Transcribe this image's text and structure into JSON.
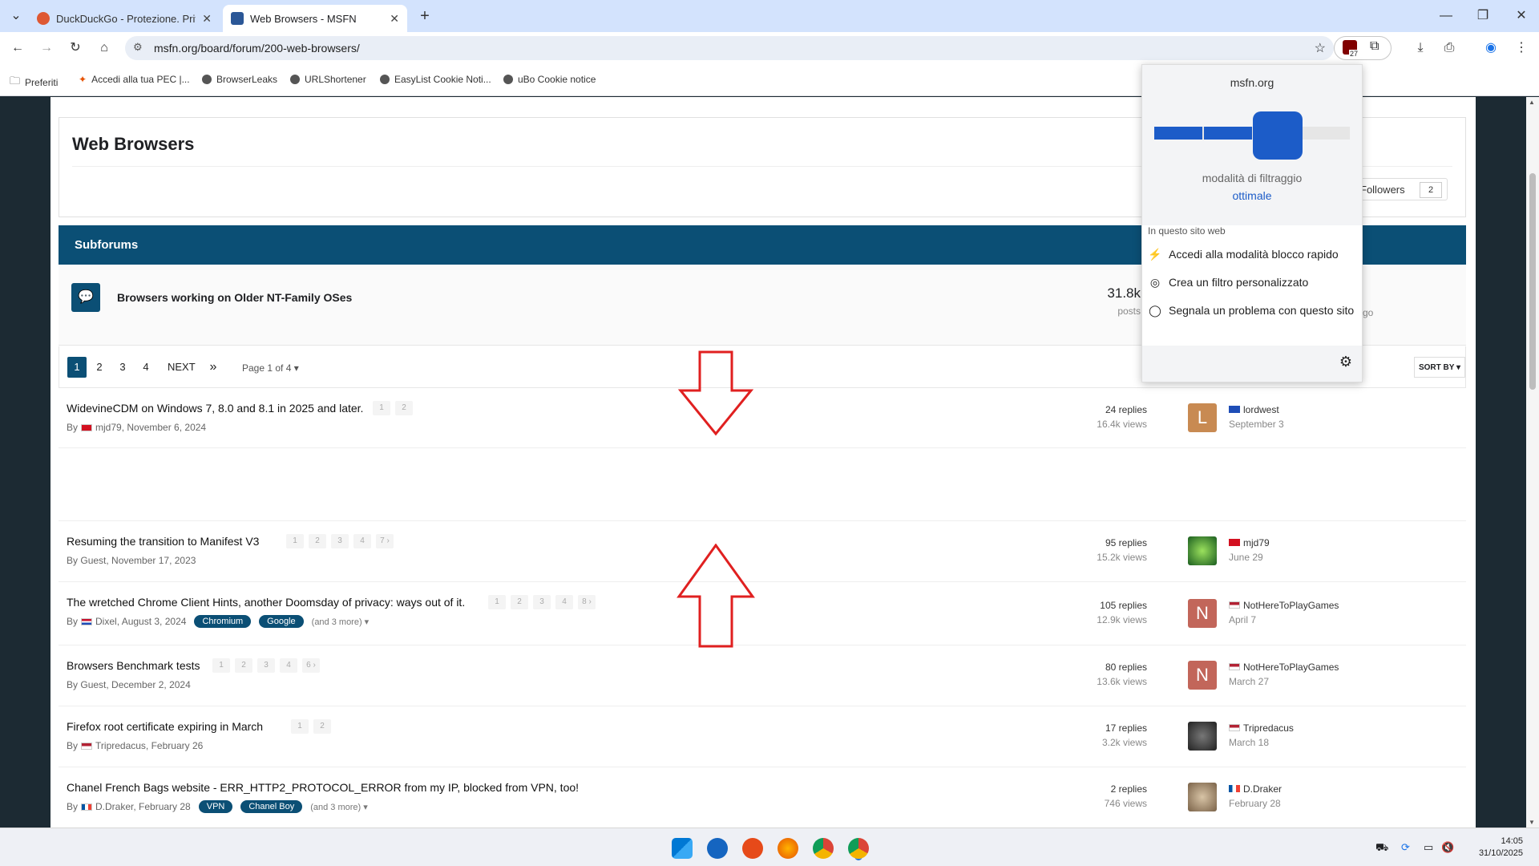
{
  "browser": {
    "tabs": [
      {
        "label": "DuckDuckGo - Protezione. Priva",
        "color": "#de5833"
      },
      {
        "label": "Web Browsers - MSFN",
        "color": "#2b5797"
      }
    ],
    "url": "msfn.org/board/forum/200-web-browsers/",
    "ext_badge": "27",
    "bookmarks": [
      {
        "label": "Preferiti"
      },
      {
        "label": "Accedi alla tua PEC |..."
      },
      {
        "label": "BrowserLeaks"
      },
      {
        "label": "URLShortener"
      },
      {
        "label": "EasyList Cookie Noti..."
      },
      {
        "label": "uBo Cookie notice"
      }
    ]
  },
  "page": {
    "title": "Web Browsers",
    "followers_label": "Followers",
    "followers_count": "2",
    "subforums_label": "Subforums",
    "subforum": {
      "title": "Browsers working on Older NT-Family OSes",
      "count": "31.8k",
      "posts_label": "posts",
      "ago": "go"
    },
    "pager": {
      "pages": [
        "1",
        "2",
        "3",
        "4"
      ],
      "next": "NEXT",
      "last": "»",
      "info": "Page 1 of 4 ▾",
      "sort": "SORT BY ▾"
    },
    "topics": [
      {
        "title": "WidevineCDM on Windows 7, 8.0 and 8.1 in 2025 and later.",
        "pages": [
          "1",
          "2"
        ],
        "by": "By",
        "author": "mjd79, November 6, 2024",
        "flag": "#d31020",
        "replies": "24 replies",
        "views": "16.4k views",
        "avatar_letter": "L",
        "avatar_color": "#c88a52",
        "last_user": "lordwest",
        "last_flag": "#1e4db7",
        "last_date": "September 3",
        "tags": [],
        "more": ""
      },
      {
        "title": "Resuming the transition to Manifest V3",
        "pages": [
          "1",
          "2",
          "3",
          "4",
          "7 ›"
        ],
        "by": "By",
        "author": "Guest, November 17, 2023",
        "flag": "",
        "replies": "95 replies",
        "views": "15.2k views",
        "avatar_letter": "",
        "avatar_color": "#2e7d32",
        "last_user": "mjd79",
        "last_flag": "#d31020",
        "last_date": "June 29",
        "tags": [],
        "more": ""
      },
      {
        "title": "The wretched Chrome Client Hints, another Doomsday of privacy: ways out of it.",
        "pages": [
          "1",
          "2",
          "3",
          "4",
          "8 ›"
        ],
        "by": "By",
        "author": "Dixel, August 3, 2024",
        "flag": "#1e4db7",
        "replies": "105 replies",
        "views": "12.9k views",
        "avatar_letter": "N",
        "avatar_color": "#c2665a",
        "last_user": "NotHereToPlayGames",
        "last_flag": "#b22234",
        "last_date": "April 7",
        "tags": [
          "Chromium",
          "Google"
        ],
        "more": "(and 3 more) ▾"
      },
      {
        "title": "Browsers Benchmark tests",
        "pages": [
          "1",
          "2",
          "3",
          "4",
          "6 ›"
        ],
        "by": "By",
        "author": "Guest, December 2, 2024",
        "flag": "",
        "replies": "80 replies",
        "views": "13.6k views",
        "avatar_letter": "N",
        "avatar_color": "#c2665a",
        "last_user": "NotHereToPlayGames",
        "last_flag": "#b22234",
        "last_date": "March 27",
        "tags": [],
        "more": ""
      },
      {
        "title": "Firefox root certificate expiring in March",
        "pages": [
          "1",
          "2"
        ],
        "by": "By",
        "author": "Tripredacus, February 26",
        "flag": "#b22234",
        "replies": "17 replies",
        "views": "3.2k views",
        "avatar_letter": "",
        "avatar_color": "#3a3a2e",
        "last_user": "Tripredacus",
        "last_flag": "#b22234",
        "last_date": "March 18",
        "tags": [],
        "more": ""
      },
      {
        "title": "Chanel French Bags website - ERR_HTTP2_PROTOCOL_ERROR from my IP, blocked from VPN, too!",
        "pages": [],
        "by": "By",
        "author": "D.Draker, February 28",
        "flag": "#0055a4",
        "replies": "2 replies",
        "views": "746 views",
        "avatar_letter": "",
        "avatar_color": "#8c7a62",
        "last_user": "D.Draker",
        "last_flag": "#0055a4",
        "last_date": "February 28",
        "tags": [
          "VPN",
          "Chanel Boy"
        ],
        "more": "(and 3 more) ▾"
      }
    ]
  },
  "popup": {
    "host": "msfn.org",
    "mode_label": "modalità di filtraggio",
    "mode_value": "ottimale",
    "section": "In questo sito web",
    "items": [
      {
        "icon": "lightning-icon",
        "glyph": "⚡",
        "label": "Accedi alla modalità blocco rapido"
      },
      {
        "icon": "eye-slash-icon",
        "glyph": "👁",
        "label": "Crea un filtro personalizzato"
      },
      {
        "icon": "comment-icon",
        "glyph": "💬",
        "label": "Segnala un problema con questo sito"
      }
    ],
    "accent": "#1c5cc8"
  },
  "taskbar": {
    "time": "14:05",
    "date": "31/10/2025"
  }
}
